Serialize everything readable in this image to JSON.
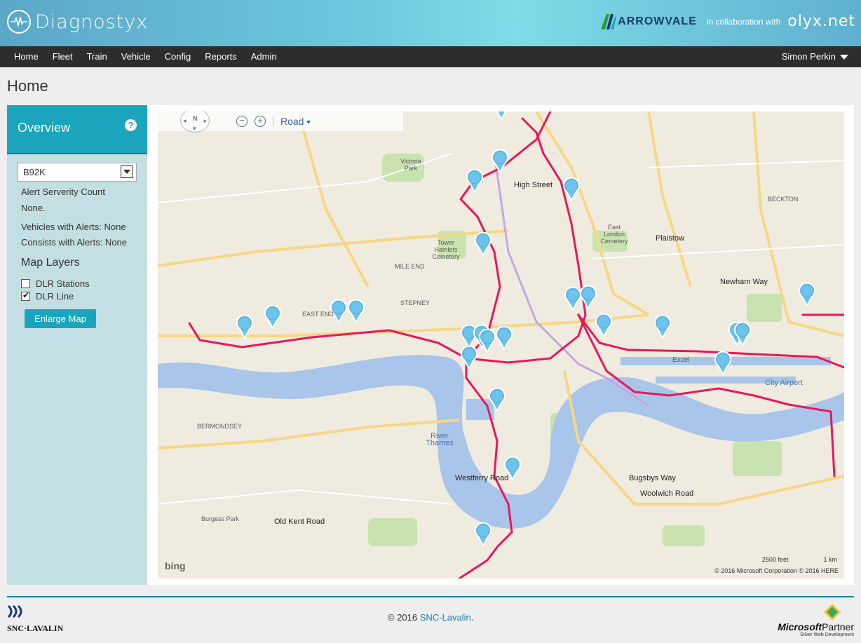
{
  "header": {
    "brand": "Diagnostyx",
    "partner_logo": "ARROWVALE",
    "collab_text": "in collaboration with",
    "partner2": "olyx.net"
  },
  "nav": {
    "items": [
      "Home",
      "Fleet",
      "Train",
      "Vehicle",
      "Config",
      "Reports",
      "Admin"
    ],
    "user": "Simon Perkin"
  },
  "page_title": "Home",
  "sidebar": {
    "title": "Overview",
    "selected_vehicle": "B92K",
    "alert_title": "Alert Serverity Count",
    "alert_value": "None.",
    "vehicles_alerts": "Vehicles with Alerts: None",
    "consists_alerts": "Consists with Alerts: None",
    "layers_title": "Map Layers",
    "layers": [
      {
        "label": "DLR Stations",
        "checked": false
      },
      {
        "label": "DLR Line",
        "checked": true
      }
    ],
    "enlarge_label": "Enlarge Map"
  },
  "map": {
    "compass_n": "N",
    "view_mode": "Road",
    "bing": "bing",
    "scale_feet": "2500 feet",
    "scale_km": "1 km",
    "copyright": "© 2016 Microsoft Corporation   © 2016 HERE",
    "places": {
      "plaistow": "Plaistow",
      "river_thames": "River Thames",
      "city_airport": "City Airport",
      "excel": "Excel",
      "mile_end": "MILE END",
      "stepney": "STEPNEY",
      "bermondsey": "BERMONDSEY",
      "beckton": "BECKTON",
      "newham_way": "Newham Way",
      "woolwich_road": "Woolwich Road",
      "bugsbys_way": "Bugsbys Way",
      "victoria_park": "Victoria Park",
      "burgess_park": "Burgess Park",
      "old_kent_road": "Old Kent Road",
      "westferry_road": "Westferry Road",
      "east_london_cemetery": "East London Cemetery",
      "tower_hamlets_cemetery": "Tower Hamlets Cemetery",
      "high_street": "High Street",
      "east_end": "EAST END"
    },
    "line_color": "#e8175d",
    "pin_color": "#6cc4ec"
  },
  "footer": {
    "company": "SNC·LAVALIN",
    "copyright_prefix": "© 2016 ",
    "copyright_link": "SNC-Lavalin",
    "copyright_suffix": ".",
    "ms_brand": "Microsoft",
    "ms_partner": "Partner",
    "ms_sub": "Silver Web Development"
  }
}
